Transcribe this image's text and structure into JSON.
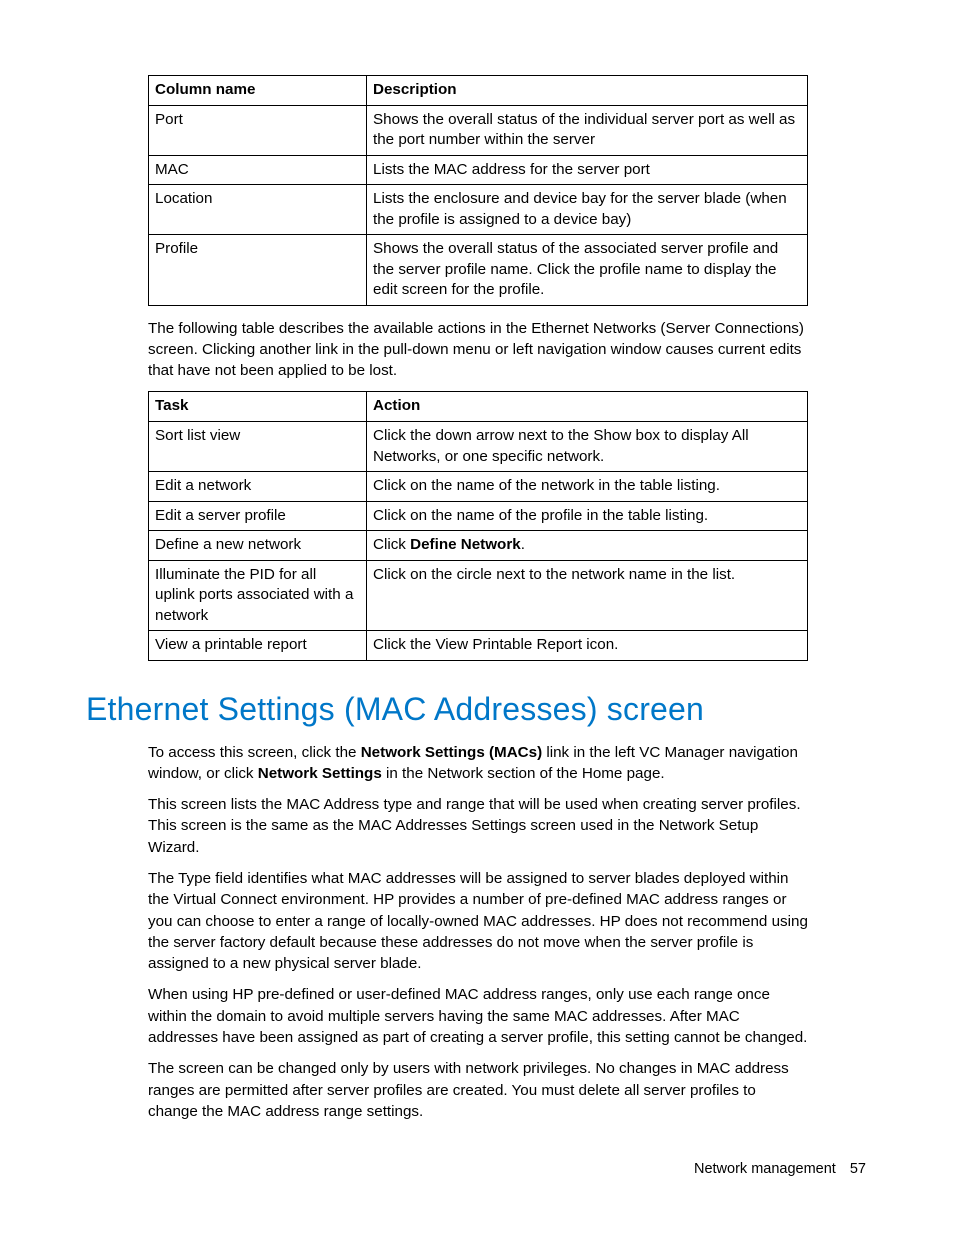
{
  "table1": {
    "headers": [
      "Column name",
      "Description"
    ],
    "rows": [
      {
        "c0": "Port",
        "c1": "Shows the overall status of the individual server port as well as the port number within the server"
      },
      {
        "c0": "MAC",
        "c1": "Lists the MAC address for the server port"
      },
      {
        "c0": "Location",
        "c1": "Lists the enclosure and device bay for the server blade (when the profile is assigned to a device bay)"
      },
      {
        "c0": "Profile",
        "c1": "Shows the overall status of the associated server profile and the server profile name. Click the profile name to display the edit screen for the profile."
      }
    ]
  },
  "para1": "The following table describes the available actions in the Ethernet Networks (Server Connections) screen. Clicking another link in the pull-down menu or left navigation window causes current edits that have not been applied to be lost.",
  "table2": {
    "headers": [
      "Task",
      "Action"
    ],
    "rows": [
      {
        "c0": "Sort list view",
        "c1": "Click the down arrow next to the Show box to display All Networks, or one specific network."
      },
      {
        "c0": "Edit a network",
        "c1": "Click on the name of the network in the table listing."
      },
      {
        "c0": "Edit a server profile",
        "c1": "Click on the name of the profile in the table listing."
      },
      {
        "c0": "Define a new network",
        "c1_pre": "Click ",
        "c1_bold": "Define Network",
        "c1_post": "."
      },
      {
        "c0": "Illuminate the PID for all uplink ports associated with a network",
        "c1": "Click on the circle next to the network name in the list."
      },
      {
        "c0": "View a printable report",
        "c1": "Click the View Printable Report icon."
      }
    ]
  },
  "heading": "Ethernet Settings (MAC Addresses) screen",
  "body": {
    "p1_pre": "To access this screen, click the ",
    "p1_b1": "Network Settings (MACs)",
    "p1_mid": " link in the left VC Manager navigation window, or click ",
    "p1_b2": "Network Settings",
    "p1_post": " in the Network section of the Home page.",
    "p2": "This screen lists the MAC Address type and range that will be used when creating server profiles. This screen is the same as the MAC Addresses Settings screen used in the Network Setup Wizard.",
    "p3": "The Type field identifies what MAC addresses will be assigned to server blades deployed within the Virtual Connect environment. HP provides a number of pre-defined MAC address ranges or you can choose to enter a range of locally-owned MAC addresses. HP does not recommend using the server factory default because these addresses do not move when the server profile is assigned to a new physical server blade.",
    "p4": "When using HP pre-defined or user-defined MAC address ranges, only use each range once within the domain to avoid multiple servers having the same MAC addresses. After MAC addresses have been assigned as part of creating a server profile, this setting cannot be changed.",
    "p5": "The screen can be changed only by users with network privileges. No changes in MAC address ranges are permitted after server profiles are created. You must delete all server profiles to change the MAC address range settings."
  },
  "footer": {
    "section": "Network management",
    "page": "57"
  }
}
